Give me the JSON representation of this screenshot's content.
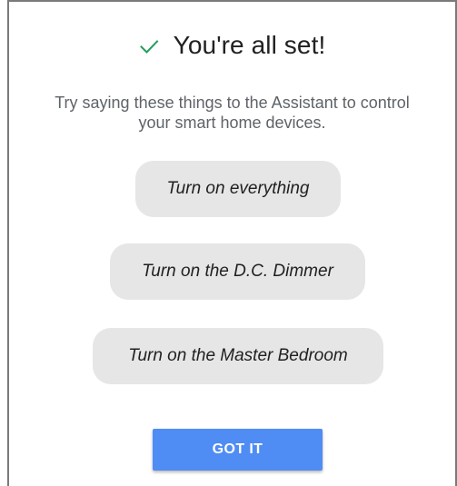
{
  "dialog": {
    "title": "You're all set!",
    "check_icon": "check-icon",
    "check_color": "#1e9e5a",
    "subtitle": "Try saying these things to the Assistant to control your smart home devices.",
    "suggestions": [
      {
        "label": "Turn on everything"
      },
      {
        "label": "Turn on the D.C. Dimmer"
      },
      {
        "label": "Turn on the Master Bedroom"
      }
    ],
    "primary_button": {
      "label": "GOT IT",
      "color": "#4f8cf4"
    }
  }
}
